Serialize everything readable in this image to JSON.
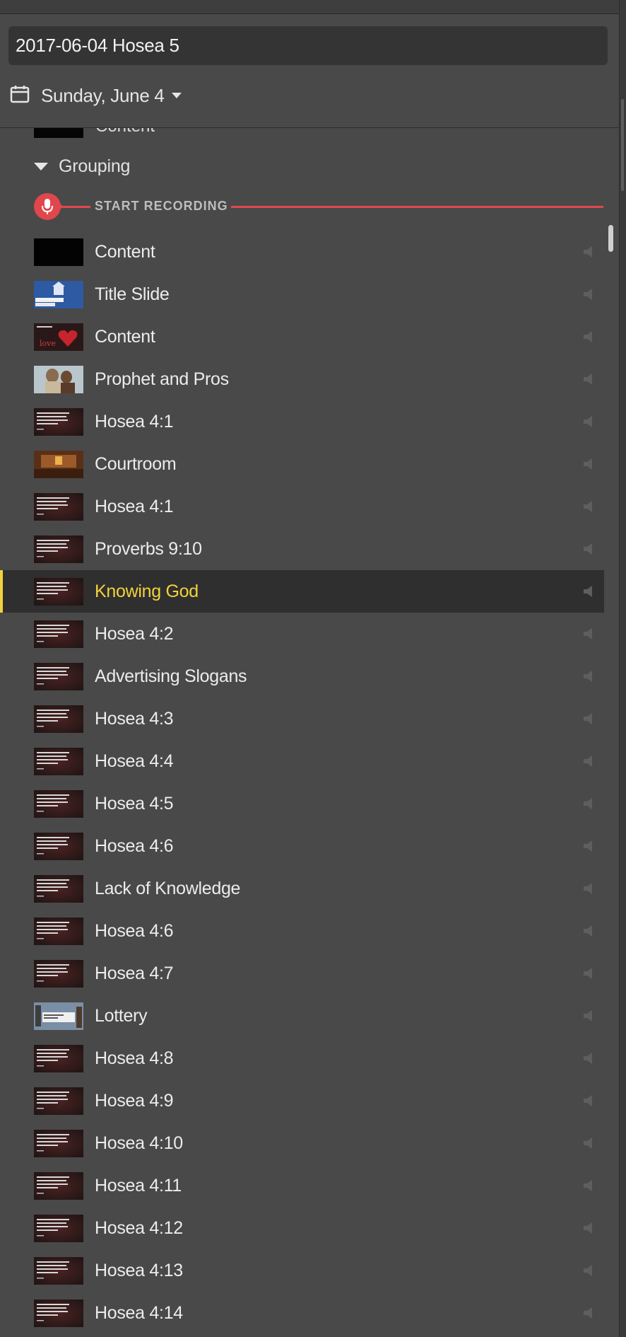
{
  "header": {
    "title_value": "2017-06-04 Hosea 5",
    "date_label": "Sunday, June 4"
  },
  "list": {
    "partial_row_label": "Content",
    "group_label": "Grouping",
    "recording_label": "START RECORDING",
    "accent_color": "#f3d23b",
    "record_color": "#e0474c",
    "items": [
      {
        "label": "Content",
        "thumb": "black"
      },
      {
        "label": "Title Slide",
        "thumb": "blue-church"
      },
      {
        "label": "Content",
        "thumb": "red-heart"
      },
      {
        "label": "Prophet and Pros",
        "thumb": "photo-people"
      },
      {
        "label": "Hosea 4:1",
        "thumb": "verse-text"
      },
      {
        "label": "Courtroom",
        "thumb": "courtroom"
      },
      {
        "label": "Hosea 4:1",
        "thumb": "verse-text"
      },
      {
        "label": "Proverbs 9:10",
        "thumb": "verse-text"
      },
      {
        "label": "Knowing God",
        "thumb": "verse-text",
        "active": true
      },
      {
        "label": "Hosea 4:2",
        "thumb": "verse-text"
      },
      {
        "label": "Advertising Slogans",
        "thumb": "verse-text"
      },
      {
        "label": "Hosea 4:3",
        "thumb": "verse-text"
      },
      {
        "label": "Hosea 4:4",
        "thumb": "verse-text"
      },
      {
        "label": "Hosea 4:5",
        "thumb": "verse-text"
      },
      {
        "label": "Hosea 4:6",
        "thumb": "verse-text"
      },
      {
        "label": "Lack of Knowledge",
        "thumb": "verse-text"
      },
      {
        "label": "Hosea 4:6",
        "thumb": "verse-text"
      },
      {
        "label": "Hosea 4:7",
        "thumb": "verse-text"
      },
      {
        "label": "Lottery",
        "thumb": "lottery"
      },
      {
        "label": "Hosea 4:8",
        "thumb": "verse-text"
      },
      {
        "label": "Hosea 4:9",
        "thumb": "verse-text"
      },
      {
        "label": "Hosea 4:10",
        "thumb": "verse-text"
      },
      {
        "label": "Hosea 4:11",
        "thumb": "verse-text"
      },
      {
        "label": "Hosea 4:12",
        "thumb": "verse-text"
      },
      {
        "label": "Hosea 4:13",
        "thumb": "verse-text"
      },
      {
        "label": "Hosea 4:14",
        "thumb": "verse-text"
      }
    ]
  }
}
